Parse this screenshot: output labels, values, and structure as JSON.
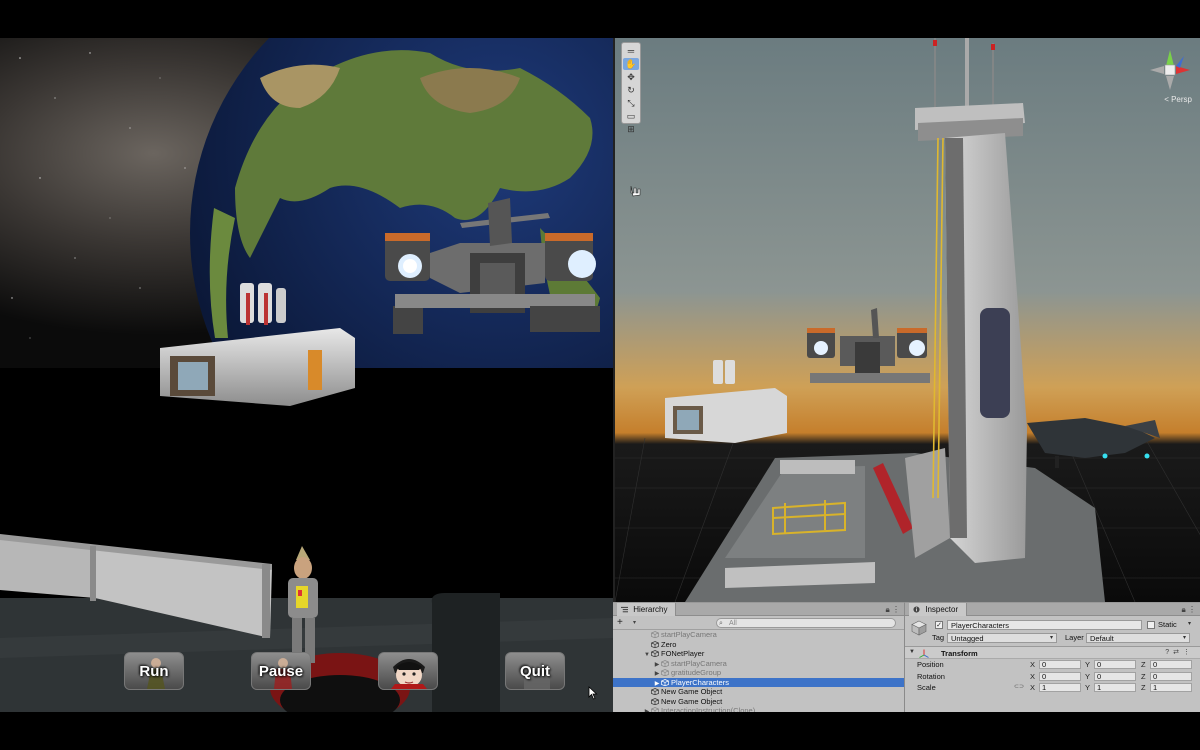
{
  "game_view": {
    "buttons": [
      {
        "label": "Run"
      },
      {
        "label": "Pause"
      },
      {
        "label": ""
      },
      {
        "label": "Quit"
      }
    ]
  },
  "scene_view": {
    "tools": [
      "hand-tool",
      "move-tool",
      "rotate-tool",
      "scale-tool",
      "rect-tool",
      "transform-tool"
    ],
    "projection_label": "< Persp"
  },
  "hierarchy": {
    "tab_label": "Hierarchy",
    "add_symbol": "+",
    "search_placeholder": "All",
    "rows": [
      {
        "label": "startPlayCamera",
        "indent": 1,
        "arrow": "",
        "dim": true,
        "selected": false
      },
      {
        "label": "Zero",
        "indent": 1,
        "arrow": "",
        "dim": false,
        "selected": false
      },
      {
        "label": "FONetPlayer",
        "indent": 1,
        "arrow": "▼",
        "dim": false,
        "selected": false
      },
      {
        "label": "startPlayCamera",
        "indent": 2,
        "arrow": "▶",
        "dim": true,
        "selected": false
      },
      {
        "label": "gratitudeGroup",
        "indent": 2,
        "arrow": "▶",
        "dim": true,
        "selected": false
      },
      {
        "label": "PlayerCharacters",
        "indent": 2,
        "arrow": "▶",
        "dim": false,
        "selected": true
      },
      {
        "label": "New Game Object",
        "indent": 1,
        "arrow": "",
        "dim": false,
        "selected": false
      },
      {
        "label": "New Game Object",
        "indent": 1,
        "arrow": "",
        "dim": false,
        "selected": false
      },
      {
        "label": "InteractionInstruction(Clone)",
        "indent": 1,
        "arrow": "▶",
        "dim": true,
        "selected": false
      }
    ]
  },
  "inspector": {
    "tab_label": "Inspector",
    "object_name": "PlayerCharacters",
    "static_label": "Static",
    "tag_label": "Tag",
    "tag_value": "Untagged",
    "layer_label": "Layer",
    "layer_value": "Default",
    "component_title": "Transform",
    "rows": [
      {
        "label": "Position",
        "x": "0",
        "y": "0",
        "z": "0"
      },
      {
        "label": "Rotation",
        "x": "0",
        "y": "0",
        "z": "0"
      },
      {
        "label": "Scale",
        "x": "1",
        "y": "1",
        "z": "1"
      }
    ],
    "axis_labels": [
      "X",
      "Y",
      "Z"
    ]
  },
  "colors": {
    "selection": "#3d73c8",
    "panel_bg": "#c2c2c2",
    "sky_top": "#6f7d80",
    "sky_horizon": "#d89a3a"
  }
}
